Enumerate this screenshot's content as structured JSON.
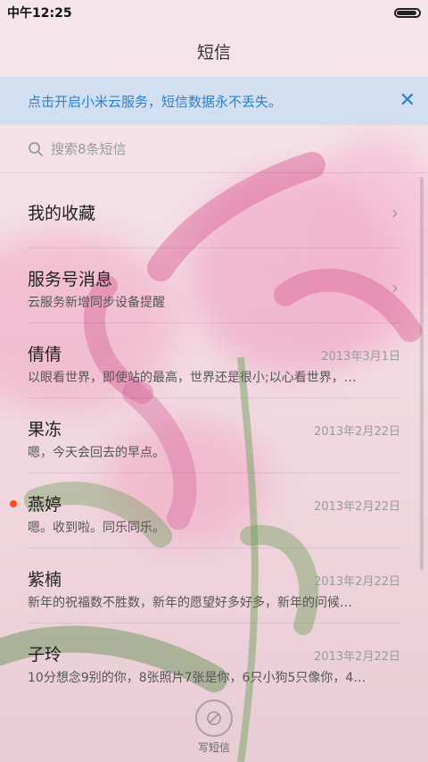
{
  "status_bar": {
    "time": "中午12:25",
    "battery_level": 0.9
  },
  "title": "短信",
  "banner": {
    "text": "点击开启小米云服务，短信数据永不丢失。"
  },
  "search": {
    "placeholder": "搜索8条短信"
  },
  "conversations": [
    {
      "name": "我的收藏",
      "preview": "",
      "date": "",
      "arrow": true,
      "unread": false
    },
    {
      "name": "服务号消息",
      "preview": "云服务新增同步设备提醒",
      "date": "",
      "arrow": true,
      "unread": false
    },
    {
      "name": "倩倩",
      "preview": "以眼看世界，即使站的最高，世界还是很小;以心看世界，…",
      "date": "2013年3月1日",
      "arrow": false,
      "unread": false
    },
    {
      "name": "果冻",
      "preview": "嗯，今天会回去的早点。",
      "date": "2013年2月22日",
      "arrow": false,
      "unread": false
    },
    {
      "name": "燕婷",
      "preview": "嗯。收到啦。同乐同乐。",
      "date": "2013年2月22日",
      "arrow": false,
      "unread": true
    },
    {
      "name": "紫楠",
      "preview": "新年的祝福数不胜数，新年的愿望好多好多，新年的问候…",
      "date": "2013年2月22日",
      "arrow": false,
      "unread": false
    },
    {
      "name": "子玲",
      "preview": "10分想念9别的你，8张照片7张是你，6只小狗5只像你，4…",
      "date": "2013年2月22日",
      "arrow": false,
      "unread": false
    }
  ],
  "compose": {
    "label": "写短信"
  },
  "colors": {
    "accent": "#2a7fd4",
    "unread_dot": "#ff4d1c"
  }
}
